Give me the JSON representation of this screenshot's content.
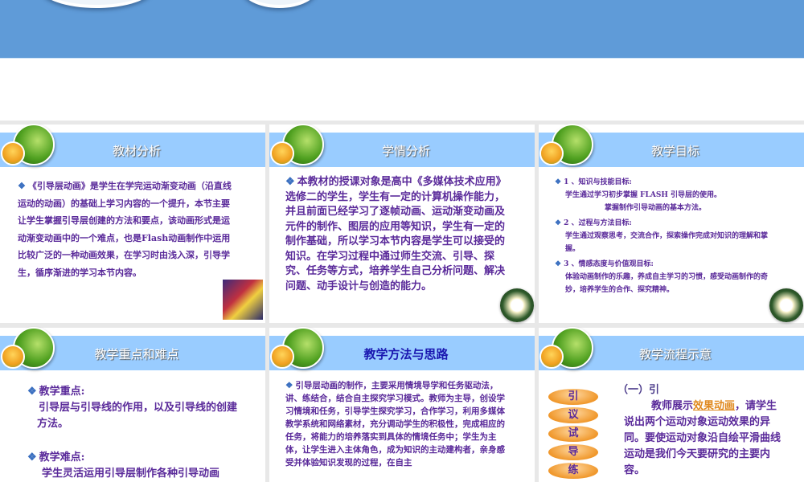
{
  "panels": [
    {
      "title": "教材分析",
      "paragraphs": [
        "《引导层动画》是学生在学完运动渐变动画（沿直线运动的动画）的基础上学习内容的一个提升，本节主要让学生掌握引导层创建的方法和要点，该动画形式是运动渐变动画中的一个难点，也是Flash动画制作中运用比较广泛的一种动画效果，在学习时由浅入深，引导学生，循序渐进的学习本节内容。"
      ]
    },
    {
      "title": "学情分析",
      "paragraphs": [
        "本教材的授课对象是高中《多媒体技术应用》选修二的学生，学生有一定的计算机操作能力，并且前面已经学习了逐帧动画、运动渐变动画及元件的制作、图层的应用等知识，学生有一定的制作基础，所以学习本节内容是学生可以接受的知识。在学习过程中通过师生交流、引导、探究、任务等方式，培养学生自己分析问题、解决问题、动手设计与创造的能力。"
      ]
    },
    {
      "title": "教学目标",
      "goals": [
        {
          "heading": "1 、知识与技能目标:",
          "lines": [
            "学生通过学习初步掌握 FLASH 引导层的使用。",
            "掌握制作引导动画的基本方法。"
          ]
        },
        {
          "heading": "2 、过程与方法目标:",
          "lines": [
            "学生通过观察思考，交流合作，探索操作完成对知识的理解和掌握。"
          ]
        },
        {
          "heading": "3 、情感态度与价值观目标:",
          "lines": [
            "体验动画制作的乐趣，养成自主学习的习惯，感受动画制作的奇妙，培养学生的合作、探究精神。"
          ]
        }
      ]
    },
    {
      "title": "教学重点和难点",
      "key_heading": "教学重点:",
      "key_text": "引导层与引导线的作用，以及引导线的创建方法。",
      "diff_heading": "教学难点:",
      "diff_text": "学生灵活运用引导层制作各种引导动画"
    },
    {
      "title": "教学方法与思路",
      "paragraphs": [
        "引导层动画的制作，主要采用情境导学和任务驱动法，讲、练结合，结合自主探究学习模式。教师为主导，创设学习情境和任务，引导学生探究学习，合作学习，利用多媒体教学系统和网络素材，充分调动学生的积极性，完成相应的任务，将能力的培养落实到具体的情境任务中；学生为主体，让学生进入主体角色，成为知识的主动建构者，亲身感受并体验知识发现的过程，在自主"
      ]
    },
    {
      "title": "教学流程示意",
      "steps": [
        "引",
        "议",
        "试",
        "导",
        "练"
      ],
      "section": "（一）引",
      "text_pre": "教师展示",
      "link": "效果动画",
      "text_post": "，请学生说出两个运动对象运动效果的异同。要使运动对象沿自绘平滑曲线运动是我们今天要研究的主要内容。"
    }
  ],
  "colors": {
    "header": "#99ccff",
    "topband": "#5f9bd8",
    "text": "#5a2a9a",
    "link": "#e08a20"
  }
}
